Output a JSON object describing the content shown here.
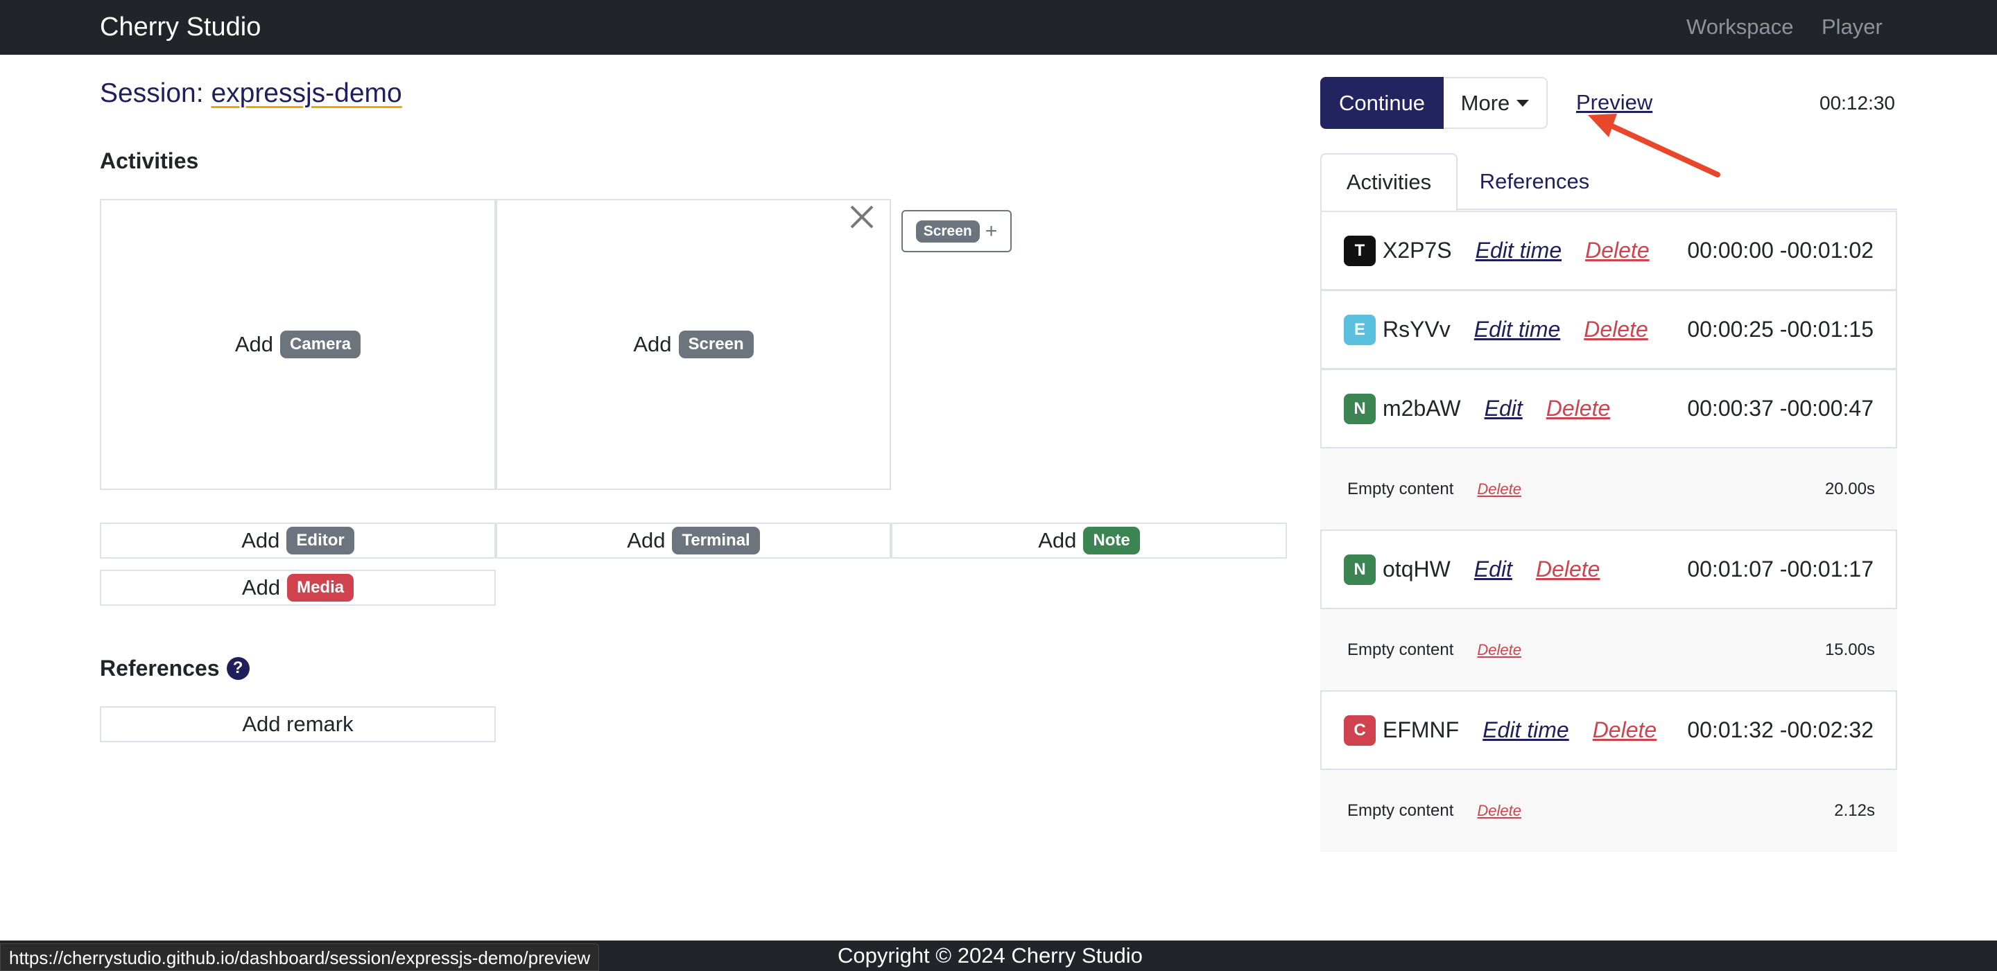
{
  "navbar": {
    "brand": "Cherry Studio",
    "links": [
      "Workspace",
      "Player"
    ]
  },
  "session": {
    "prefix": "Session:",
    "name": "expressjs-demo"
  },
  "activities_heading": "Activities",
  "references_heading": "References",
  "help_icon": "?",
  "tiles": {
    "add_word": "Add",
    "camera": "Camera",
    "screen": "Screen",
    "editor": "Editor",
    "terminal": "Terminal",
    "note": "Note",
    "media": "Media"
  },
  "add_screen_chip": {
    "label": "Screen",
    "plus": "+"
  },
  "add_remark": "Add remark",
  "toolbar": {
    "continue": "Continue",
    "more": "More",
    "preview": "Preview",
    "timer": "00:12:30"
  },
  "tabs": [
    "Activities",
    "References"
  ],
  "activity_list": [
    {
      "badge": "T",
      "id": "X2P7S",
      "edit": "Edit time",
      "delete": "Delete",
      "time": "00:00:00 -00:01:02"
    },
    {
      "badge": "E",
      "id": "RsYVv",
      "edit": "Edit time",
      "delete": "Delete",
      "time": "00:00:25 -00:01:15"
    },
    {
      "badge": "N",
      "id": "m2bAW",
      "edit": "Edit",
      "delete": "Delete",
      "time": "00:00:37 -00:00:47"
    },
    {
      "badge": "N",
      "id": "otqHW",
      "edit": "Edit",
      "delete": "Delete",
      "time": "00:01:07 -00:01:17"
    },
    {
      "badge": "C",
      "id": "EFMNF",
      "edit": "Edit time",
      "delete": "Delete",
      "time": "00:01:32 -00:02:32"
    }
  ],
  "empty_rows": [
    {
      "text": "Empty content",
      "delete": "Delete",
      "duration": "20.00s"
    },
    {
      "text": "Empty content",
      "delete": "Delete",
      "duration": "15.00s"
    },
    {
      "text": "Empty content",
      "delete": "Delete",
      "duration": "2.12s"
    }
  ],
  "footer": "Copyright © 2024 Cherry Studio",
  "status_url": "https://cherrystudio.github.io/dashboard/session/expressjs-demo/preview",
  "colors": {
    "navbar": "#212529",
    "primary": "#23235f",
    "danger": "#d0434e",
    "success": "#3b8552",
    "secondary": "#6c757d",
    "info": "#5bc0de",
    "arrow": "#e8472b"
  }
}
